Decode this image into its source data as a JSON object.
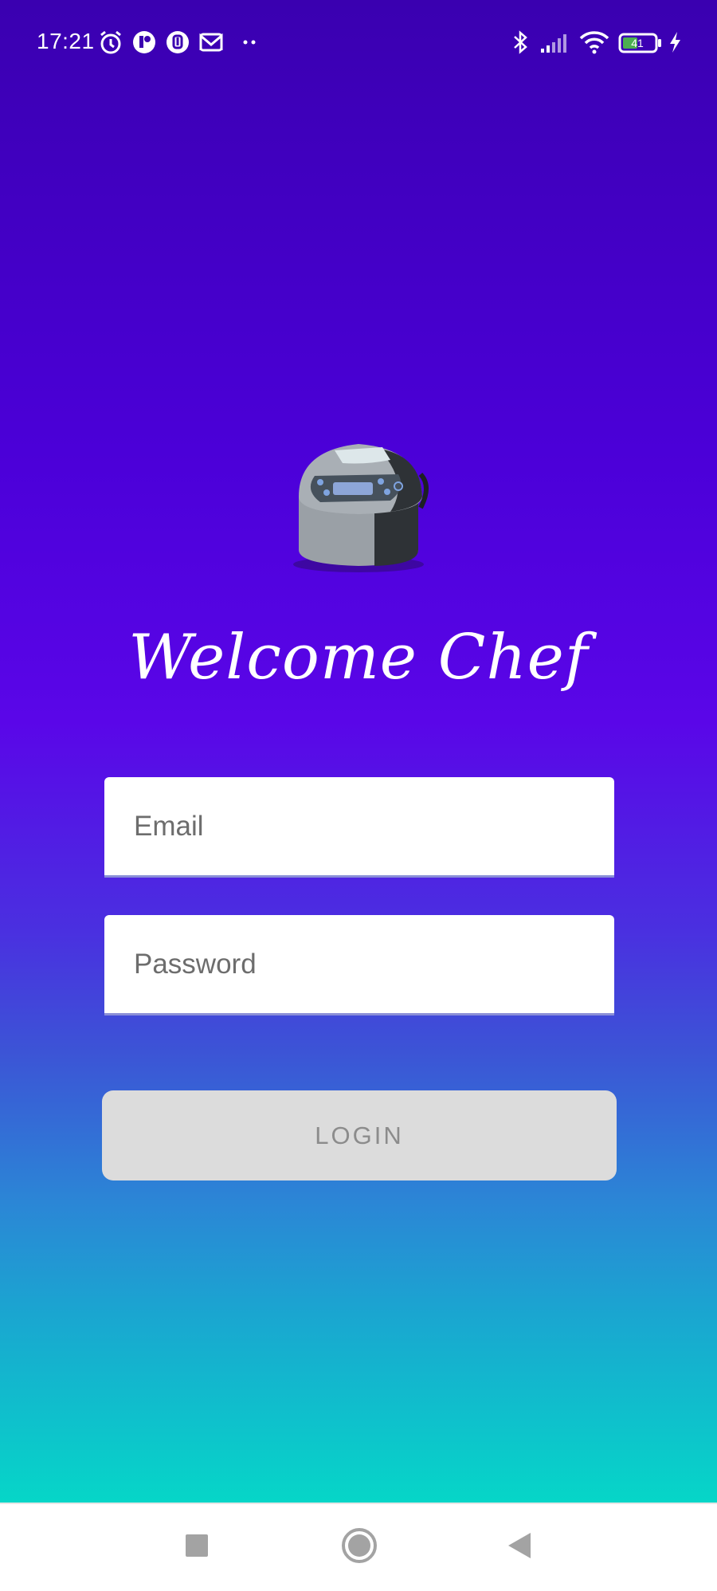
{
  "status_bar": {
    "time": "17:21",
    "left_icons": [
      "alarm-icon",
      "app-notification-icon",
      "app-notification-icon",
      "gmail-icon",
      "more-dots-icon"
    ],
    "right_icons": [
      "bluetooth-icon",
      "signal-icon",
      "wifi-icon",
      "battery-icon",
      "charging-icon"
    ],
    "battery_level": "41"
  },
  "app": {
    "logo_icon": "rice-cooker-icon",
    "welcome_text": "Welcome Chef",
    "email_placeholder": "Email",
    "password_placeholder": "Password",
    "login_label": "LOGIN",
    "login_enabled": false
  },
  "colors": {
    "gradient_top": "#3a00b0",
    "gradient_mid": "#5a06e8",
    "gradient_bottom": "#06d6c8",
    "button_disabled_bg": "#dcdcdc",
    "button_disabled_text": "#8c8c8c"
  },
  "nav_bar": {
    "buttons": [
      "recents-square-icon",
      "home-circle-icon",
      "back-triangle-icon"
    ]
  }
}
